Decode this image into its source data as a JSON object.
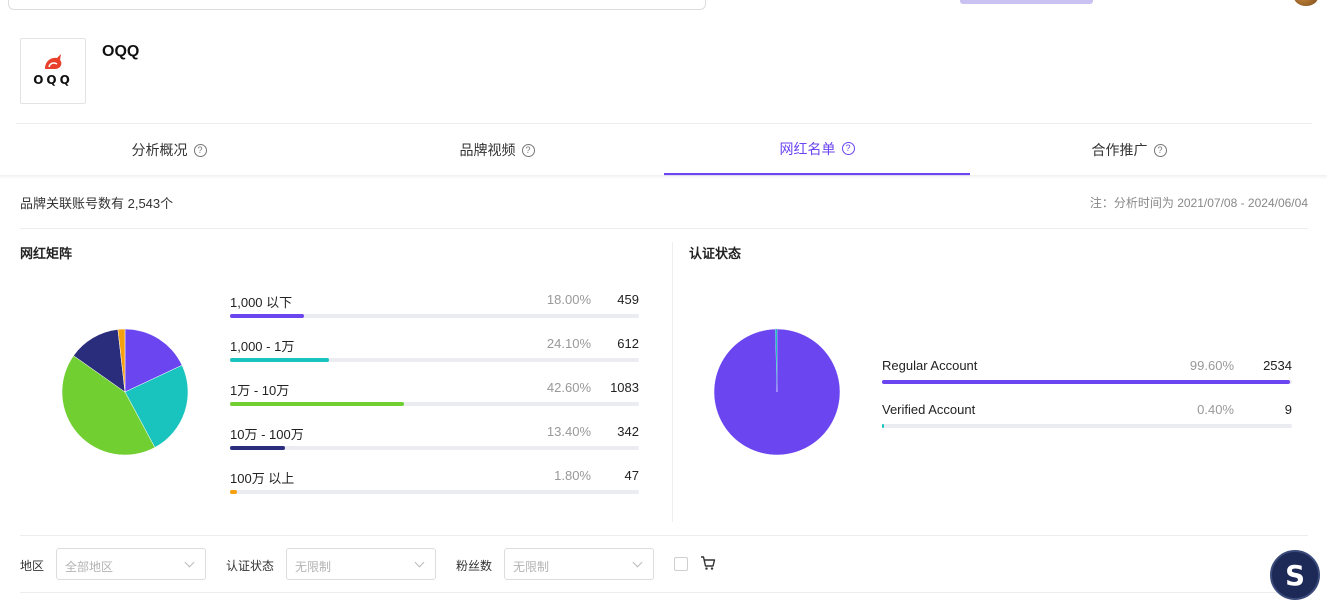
{
  "brand": {
    "name": "OQQ",
    "logo_text": "OQQ"
  },
  "tabs": [
    {
      "label": "分析概况",
      "help": "?"
    },
    {
      "label": "品牌视频",
      "help": "?"
    },
    {
      "label": "网红名单",
      "help": "?"
    },
    {
      "label": "合作推广",
      "help": "?"
    }
  ],
  "active_tab": "网红名单",
  "summary": "品牌关联账号数有 2,543个",
  "note": "注：分析时间为 2021/07/08 - 2024/06/04",
  "colors": {
    "accent": "#6b45f0",
    "purple": "#6b45f0",
    "teal": "#19c3be",
    "green": "#72cf32",
    "navy": "#2a2d7c",
    "orange": "#f5a00f"
  },
  "matrix": {
    "title": "网红矩阵",
    "rows": [
      {
        "label": "1,000 以下",
        "percent": "18.00%",
        "count": "459",
        "share": 18.0,
        "color": "#6b45f0"
      },
      {
        "label": "1,000 - 1万",
        "percent": "24.10%",
        "count": "612",
        "share": 24.1,
        "color": "#19c3be"
      },
      {
        "label": "1万 - 10万",
        "percent": "42.60%",
        "count": "1083",
        "share": 42.6,
        "color": "#72cf32"
      },
      {
        "label": "10万 - 100万",
        "percent": "13.40%",
        "count": "342",
        "share": 13.4,
        "color": "#2a2d7c"
      },
      {
        "label": "100万 以上",
        "percent": "1.80%",
        "count": "47",
        "share": 1.8,
        "color": "#f5a00f"
      }
    ]
  },
  "verification": {
    "title": "认证状态",
    "rows": [
      {
        "label": "Regular Account",
        "percent": "99.60%",
        "count": "2534",
        "share": 99.6,
        "color": "#6b45f0"
      },
      {
        "label": "Verified Account",
        "percent": "0.40%",
        "count": "9",
        "share": 0.4,
        "color": "#19c3be"
      }
    ]
  },
  "filters": {
    "region": {
      "label": "地区",
      "placeholder": "全部地区"
    },
    "verify": {
      "label": "认证状态",
      "placeholder": "无限制"
    },
    "fans": {
      "label": "粉丝数",
      "placeholder": "无限制"
    }
  },
  "icons": {
    "cart": "cart-icon",
    "help": "question-circle-icon",
    "chevron": "chevron-down-icon",
    "fab": "s-logo-icon"
  }
}
